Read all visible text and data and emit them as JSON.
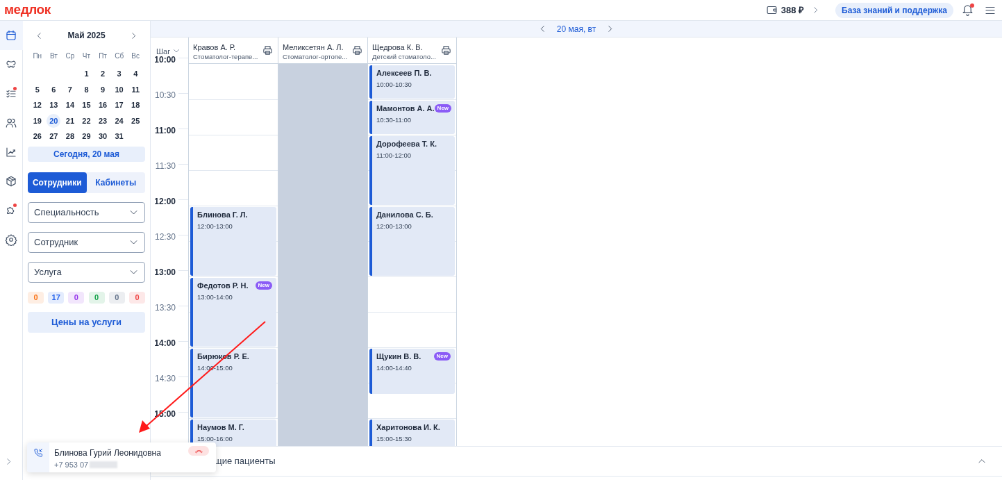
{
  "header": {
    "logo": "медлок",
    "balance": "388 ₽",
    "support": "База знаний и поддержка",
    "notification_dot": true
  },
  "rail": [
    {
      "selected": true,
      "dot": false
    },
    {
      "selected": false,
      "dot": false
    },
    {
      "selected": false,
      "dot": true
    },
    {
      "selected": false,
      "dot": false
    },
    {
      "selected": false,
      "dot": false
    },
    {
      "selected": false,
      "dot": false
    },
    {
      "selected": false,
      "dot": true
    },
    {
      "selected": false,
      "dot": false
    }
  ],
  "calendar": {
    "month": "Май 2025",
    "weekdays": [
      "Пн",
      "Вт",
      "Ср",
      "Чт",
      "Пт",
      "Сб",
      "Вс"
    ],
    "weeks": [
      [
        {
          "day": "1",
          "selected": false
        },
        {
          "day": "2",
          "selected": false
        },
        {
          "day": "3",
          "selected": false
        },
        {
          "day": "4",
          "selected": false
        }
      ],
      [
        {
          "day": "5",
          "selected": false
        },
        {
          "day": "6",
          "selected": false
        },
        {
          "day": "7",
          "selected": false
        },
        {
          "day": "8",
          "selected": false
        },
        {
          "day": "9",
          "selected": false
        },
        {
          "day": "10",
          "selected": false
        },
        {
          "day": "11",
          "selected": false
        }
      ],
      [
        {
          "day": "12",
          "selected": false
        },
        {
          "day": "13",
          "selected": false
        },
        {
          "day": "14",
          "selected": false
        },
        {
          "day": "15",
          "selected": false
        },
        {
          "day": "16",
          "selected": false
        },
        {
          "day": "17",
          "selected": false
        },
        {
          "day": "18",
          "selected": false
        }
      ],
      [
        {
          "day": "19",
          "selected": false
        },
        {
          "day": "20",
          "selected": true
        },
        {
          "day": "21",
          "selected": false
        },
        {
          "day": "22",
          "selected": false
        },
        {
          "day": "23",
          "selected": false
        },
        {
          "day": "24",
          "selected": false
        },
        {
          "day": "25",
          "selected": false
        }
      ],
      [
        {
          "day": "26",
          "selected": false
        },
        {
          "day": "27",
          "selected": false
        },
        {
          "day": "28",
          "selected": false
        },
        {
          "day": "29",
          "selected": false
        },
        {
          "day": "30",
          "selected": false
        },
        {
          "day": "31",
          "selected": false
        }
      ]
    ],
    "today_button": "Сегодня, 20 мая"
  },
  "tabs": [
    {
      "label": "Сотрудники",
      "selected": true
    },
    {
      "label": "Кабинеты",
      "selected": false
    }
  ],
  "filters": [
    {
      "placeholder": "Специальность"
    },
    {
      "placeholder": "Сотрудник"
    },
    {
      "placeholder": "Услуга"
    }
  ],
  "counters": [
    {
      "value": "0",
      "color": "#f97316"
    },
    {
      "value": "17",
      "color": "#2563eb"
    },
    {
      "value": "0",
      "color": "#9333ea"
    },
    {
      "value": "0",
      "color": "#16a34a"
    },
    {
      "value": "0",
      "color": "#64748b"
    },
    {
      "value": "0",
      "color": "#ef4444"
    }
  ],
  "prices_button": "Цены на услуги",
  "schedule": {
    "date": "20 мая, вт",
    "step": "Шаг",
    "times": [
      {
        "label": "10:00",
        "major": true
      },
      {
        "label": "10:30",
        "major": false
      },
      {
        "label": "11:00",
        "major": true
      },
      {
        "label": "11:30",
        "major": false
      },
      {
        "label": "12:00",
        "major": true
      },
      {
        "label": "12:30",
        "major": false
      },
      {
        "label": "13:00",
        "major": true
      },
      {
        "label": "13:30",
        "major": false
      },
      {
        "label": "14:00",
        "major": true
      },
      {
        "label": "14:30",
        "major": false
      },
      {
        "label": "15:00",
        "major": true
      }
    ],
    "columns": [
      {
        "name": "Кравов А. Р.",
        "role": "Стоматолог-терапе...",
        "blocked": false,
        "appointments": [
          {
            "patient": "Блинова Г. Л.",
            "time": "12:00-13:00",
            "new": false
          },
          {
            "patient": "Федотов Р. Н.",
            "time": "13:00-14:00",
            "new": true,
            "badge": "New"
          },
          {
            "patient": "Бирюков Р. Е.",
            "time": "14:00-15:00",
            "new": false
          },
          {
            "patient": "Наумов М. Г.",
            "time": "15:00-16:00",
            "new": false
          }
        ]
      },
      {
        "name": "Меликсетян А. Л.",
        "role": "Стоматолог-ортопе...",
        "blocked": true
      },
      {
        "name": "Щедрова К. В.",
        "role": "Детский стоматоло...",
        "blocked": false,
        "appointments": [
          {
            "patient": "Алексеев П. В.",
            "time": "10:00-10:30",
            "new": false
          },
          {
            "patient": "Мамонтов А. А.",
            "time": "10:30-11:00",
            "new": true,
            "badge": "New"
          },
          {
            "patient": "Дорофеева Т. К.",
            "time": "11:00-12:00",
            "new": false
          },
          {
            "patient": "Данилова С. Б.",
            "time": "12:00-13:00",
            "new": false
          },
          {
            "patient": "Щукин В. В.",
            "time": "14:00-14:40",
            "new": true,
            "badge": "New"
          },
          {
            "patient": "Харитонова И. К.",
            "time": "15:00-15:30",
            "new": false
          }
        ]
      }
    ]
  },
  "waiting_bar": {
    "label": "щие пациенты"
  },
  "call_popup": {
    "caller": "Блинова Гурий Леонидовна",
    "phone": "+7 953 07"
  }
}
